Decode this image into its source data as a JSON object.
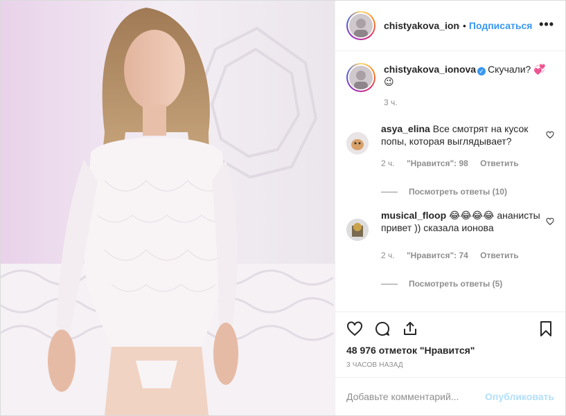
{
  "post": {
    "author": "chistyakova_ionova",
    "header_username": "chistyakova_ionc",
    "follow_label": "Подписаться",
    "more_label": "•••",
    "caption": {
      "username": "chistyakova_ionova",
      "text": "Скучали? 💞",
      "emoji_line": "😉",
      "time": "3 ч."
    },
    "comments": [
      {
        "username": "asya_elina",
        "text": "Все смотрят на кусок попы, которая выглядывает?",
        "time": "2 ч.",
        "likes": "\"Нравится\": 98",
        "reply": "Ответить",
        "view_replies": "Посмотреть ответы (10)"
      },
      {
        "username": "musical_floop",
        "text": "😂😂😂😂 ананисты привет )) сказала ионова",
        "time": "2 ч.",
        "likes": "\"Нравится\": 74",
        "reply": "Ответить",
        "view_replies": "Посмотреть ответы (5)"
      }
    ],
    "likes_count": "48 976 отметок \"Нравится\"",
    "posted_ago": "3 ЧАСОВ НАЗАД",
    "add_comment_placeholder": "Добавьте комментарий...",
    "publish_label": "Опубликовать"
  },
  "icons": [
    "heart-icon",
    "comment-icon",
    "share-icon",
    "bookmark-icon",
    "verified-icon",
    "more-options-icon"
  ],
  "colors": {
    "accent": "#3897f0",
    "publish_disabled": "#b2dffc",
    "muted": "#8e8e8e",
    "text": "#262626"
  }
}
